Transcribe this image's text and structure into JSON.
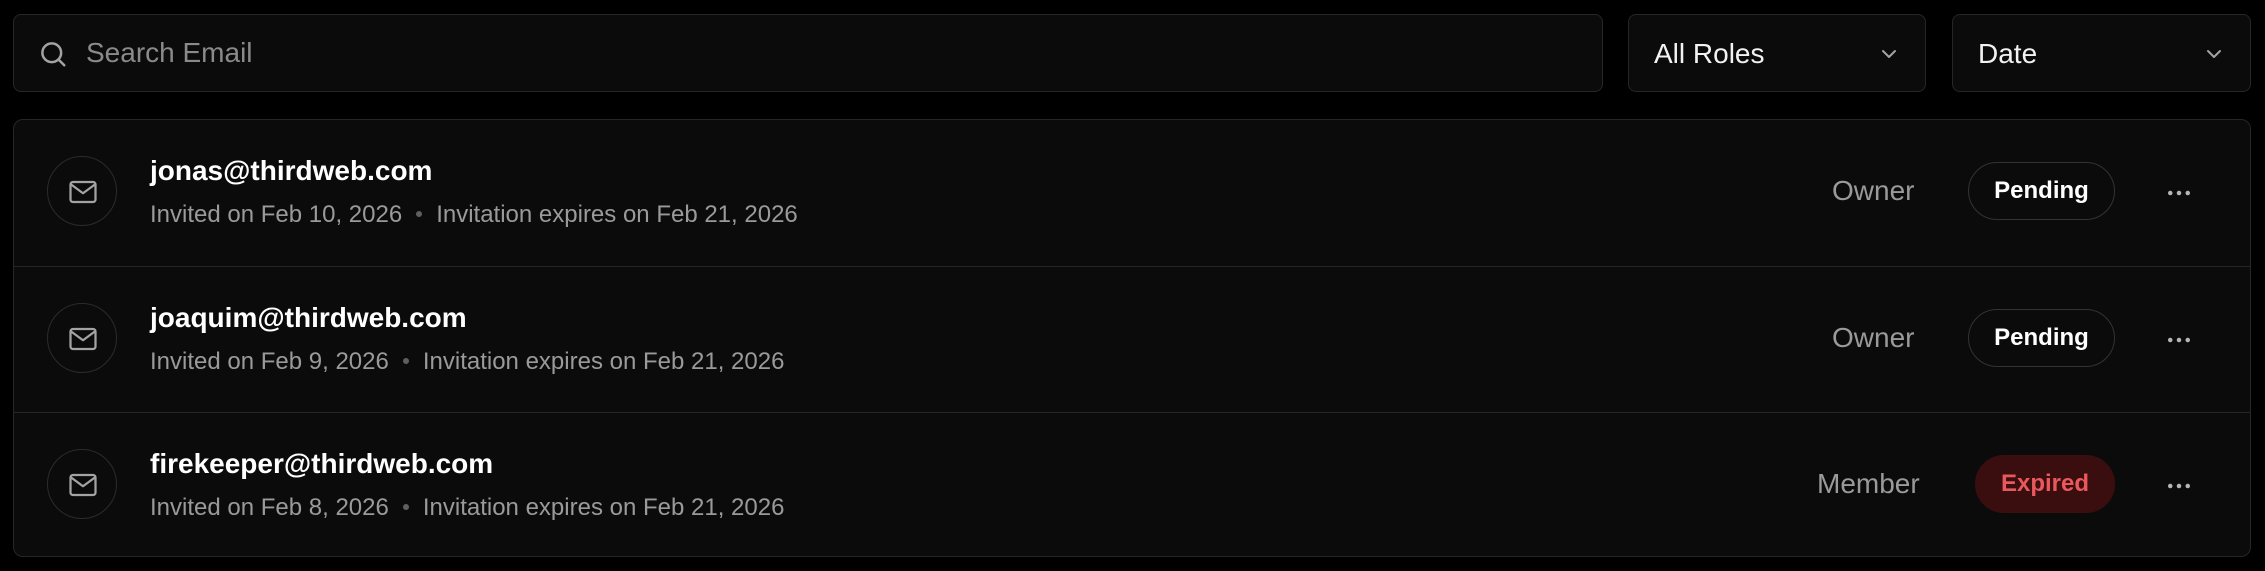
{
  "search": {
    "placeholder": "Search Email",
    "value": ""
  },
  "filters": {
    "roles_label": "All Roles",
    "sort_label": "Date"
  },
  "members": [
    {
      "email": "jonas@thirdweb.com",
      "invited": "Invited on Feb 10, 2026",
      "expires": "Invitation expires on Feb 21, 2026",
      "role": "Owner",
      "status": "Pending"
    },
    {
      "email": "joaquim@thirdweb.com",
      "invited": "Invited on Feb 9, 2026",
      "expires": "Invitation expires on Feb 21, 2026",
      "role": "Owner",
      "status": "Pending"
    },
    {
      "email": "firekeeper@thirdweb.com",
      "invited": "Invited on Feb 8, 2026",
      "expires": "Invitation expires on Feb 21, 2026",
      "role": "Member",
      "status": "Expired"
    }
  ],
  "icons": {
    "search": "search-icon",
    "chevron": "chevron-down-icon",
    "mail": "mail-icon",
    "more": "more-horizontal-icon"
  },
  "colors": {
    "background": "#000000",
    "surface": "#0b0b0b",
    "border": "#262626",
    "muted_text": "#9a9a9a",
    "expired_text": "#e8585c",
    "expired_bg": "#3a0d0f"
  }
}
